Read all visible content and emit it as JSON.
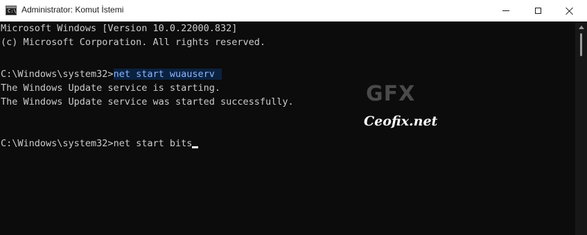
{
  "window": {
    "title": "Administrator: Komut İstemi",
    "icon_label": "C:\\.",
    "icon": "cmd-icon"
  },
  "caption_buttons": {
    "minimize_icon": "minimize-icon",
    "maximize_icon": "maximize-icon",
    "close_icon": "close-icon"
  },
  "console": {
    "line1": "Microsoft Windows [Version 10.0.22000.832]",
    "line2": "(c) Microsoft Corporation. All rights reserved.",
    "prompt1": "C:\\Windows\\system32>",
    "command1": "net start wuauserv",
    "output1": "The Windows Update service is starting.",
    "output2": "The Windows Update service was started successfully.",
    "prompt2": "C:\\Windows\\system32>",
    "command2": "net start bits"
  },
  "watermark": {
    "logo": "GFX",
    "text": "Ceofix.net"
  },
  "colors": {
    "background": "#0c0c0c",
    "text": "#cccccc",
    "selection_bg": "#0a2240",
    "selection_text": "#8fb6ff"
  }
}
